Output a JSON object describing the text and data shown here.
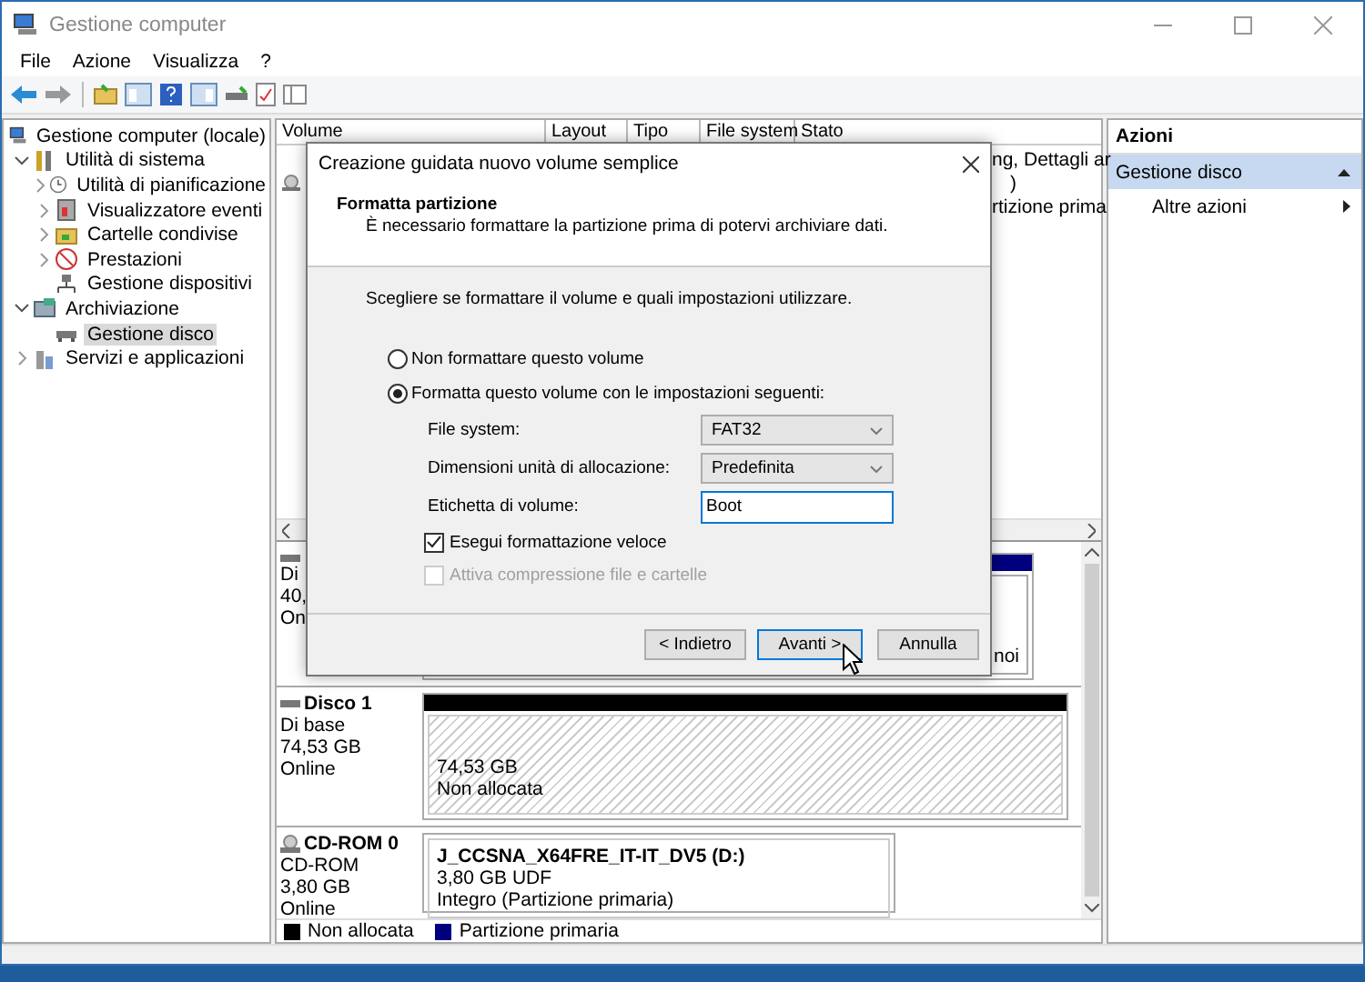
{
  "window": {
    "title": "Gestione computer"
  },
  "menu": [
    "File",
    "Azione",
    "Visualizza",
    "?"
  ],
  "tree": [
    {
      "label": "Gestione computer (locale)",
      "selected": false,
      "children": [
        {
          "label": "Utilità di sistema",
          "expanded": true,
          "selected": false,
          "children": [
            {
              "label": "Utilità di pianificazione",
              "expanded": false,
              "selected": false
            },
            {
              "label": "Visualizzatore eventi",
              "expanded": false,
              "selected": false
            },
            {
              "label": "Cartelle condivise",
              "expanded": false,
              "selected": false
            },
            {
              "label": "Prestazioni",
              "expanded": false,
              "selected": false
            },
            {
              "label": "Gestione dispositivi",
              "selected": false
            }
          ]
        },
        {
          "label": "Archiviazione",
          "expanded": true,
          "selected": false,
          "children": [
            {
              "label": "Gestione disco",
              "selected": true
            }
          ]
        },
        {
          "label": "Servizi e applicazioni",
          "expanded": false,
          "selected": false
        }
      ]
    }
  ],
  "volume_list": {
    "columns": [
      "Volume",
      "Layout",
      "Tipo",
      "File system",
      "Stato"
    ],
    "rows": [
      {
        "stato": "ng, Dettagli ar"
      },
      {
        "stato": ")"
      },
      {
        "stato": "rtizione prima"
      }
    ]
  },
  "disks": [
    {
      "kind": "disk",
      "info": [
        "Di",
        "40,",
        "On"
      ],
      "partitions": [
        {
          "kind": "primary",
          "lines": [
            "noi"
          ]
        }
      ]
    },
    {
      "kind": "disk",
      "name": "Disco 1",
      "info": [
        "Di base",
        "74,53 GB",
        "Online"
      ],
      "partitions": [
        {
          "kind": "unallocated",
          "lines": [
            "74,53 GB",
            "Non allocata"
          ]
        }
      ]
    },
    {
      "kind": "cdrom",
      "name": "CD-ROM 0",
      "info": [
        "CD-ROM",
        "3,80 GB",
        "Online"
      ],
      "partitions": [
        {
          "kind": "primary",
          "title": "J_CCSNA_X64FRE_IT-IT_DV5  (D:)",
          "lines": [
            "3,80 GB UDF",
            "Integro (Partizione primaria)"
          ]
        }
      ]
    }
  ],
  "legend": [
    {
      "label": "Non allocata",
      "color": "#000000"
    },
    {
      "label": "Partizione primaria",
      "color": "#00007f"
    }
  ],
  "actions": {
    "header": "Azioni",
    "items": [
      {
        "label": "Gestione disco",
        "kind": "section",
        "expanded": true
      },
      {
        "label": "Altre azioni",
        "kind": "submenu"
      }
    ]
  },
  "dialog": {
    "title": "Creazione guidata nuovo volume semplice",
    "heading": "Formatta partizione",
    "subheading": "È necessario formattare la partizione prima di potervi archiviare dati.",
    "prompt": "Scegliere se formattare il volume e quali impostazioni utilizzare.",
    "options": [
      {
        "label": "Non formattare questo volume",
        "selected": false
      },
      {
        "label": "Formatta questo volume con le impostazioni seguenti:",
        "selected": true
      }
    ],
    "settings": [
      {
        "kind": "select",
        "label": "File system:",
        "value": "FAT32"
      },
      {
        "kind": "select",
        "label": "Dimensioni unità di allocazione:",
        "value": "Predefinita"
      },
      {
        "kind": "input",
        "label": "Etichetta di volume:",
        "value": "Boot"
      }
    ],
    "checkboxes": [
      {
        "label": "Esegui formattazione veloce",
        "checked": true,
        "disabled": false
      },
      {
        "label": "Attiva compressione file e cartelle",
        "checked": false,
        "disabled": true
      }
    ],
    "buttons": [
      {
        "label": "< Indietro",
        "default": false
      },
      {
        "label": "Avanti >",
        "default": true
      },
      {
        "label": "Annulla",
        "default": false
      }
    ]
  }
}
